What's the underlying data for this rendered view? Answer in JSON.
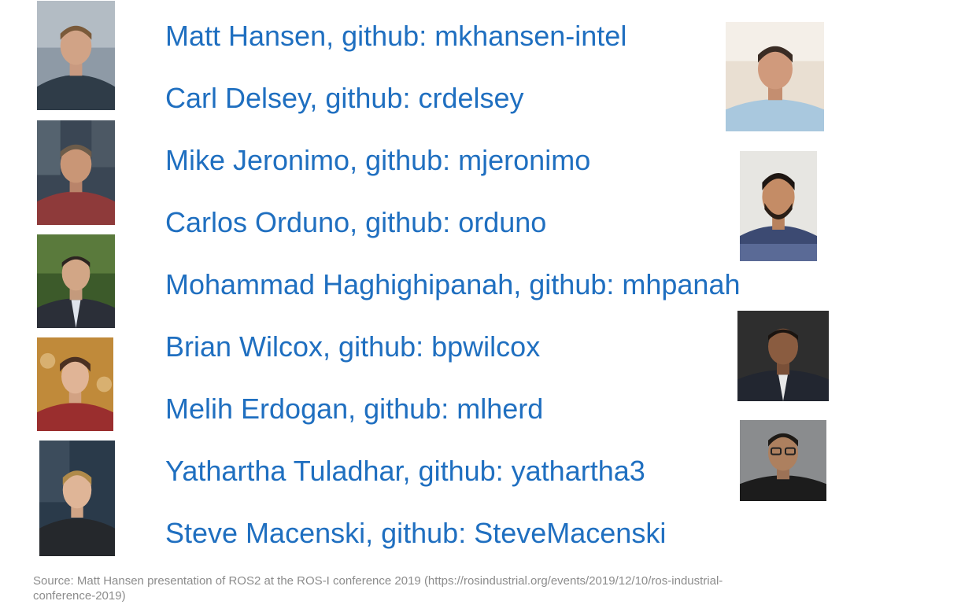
{
  "contributors": [
    {
      "label": "Matt Hansen, github: mkhansen-intel"
    },
    {
      "label": "Carl Delsey, github: crdelsey"
    },
    {
      "label": "Mike Jeronimo, github: mjeronimo"
    },
    {
      "label": "Carlos Orduno, github: orduno"
    },
    {
      "label": "Mohammad Haghighipanah, github: mhpanah"
    },
    {
      "label": "Brian Wilcox, github: bpwilcox"
    },
    {
      "label": "Melih Erdogan, github: mlherd"
    },
    {
      "label": "Yathartha Tuladhar, github: yathartha3"
    },
    {
      "label": "Steve Macenski, github: SteveMacenski"
    }
  ],
  "source_note": "Source: Matt Hansen presentation of ROS2 at the ROS-I conference 2019 (https://rosindustrial.org/events/2019/12/10/ros-industrial-conference-2019)",
  "colors": {
    "name_text": "#1f6fc0",
    "source_text": "#8c8c8c",
    "background": "#ffffff"
  }
}
